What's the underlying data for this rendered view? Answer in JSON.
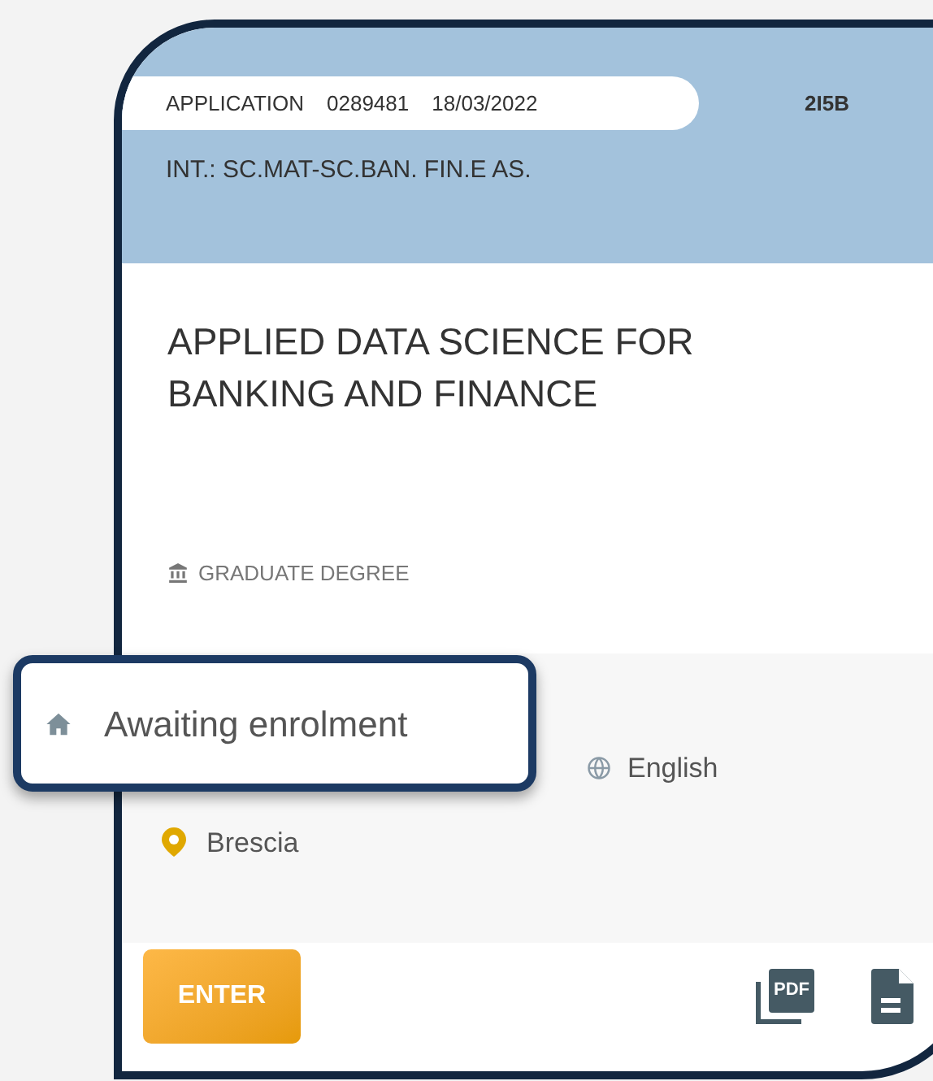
{
  "application": {
    "label": "APPLICATION",
    "number": "0289481",
    "date": "18/03/2022",
    "code": "2I5B",
    "interest": "INT.: SC.MAT-SC.BAN. FIN.E AS."
  },
  "course": {
    "title": "APPLIED DATA SCIENCE FOR BANKING AND FINANCE",
    "degree": "GRADUATE DEGREE"
  },
  "status": {
    "text": "Awaiting enrolment"
  },
  "details": {
    "language": "English",
    "location": "Brescia"
  },
  "footer": {
    "button": "ENTER",
    "pdf_label": "PDF"
  }
}
